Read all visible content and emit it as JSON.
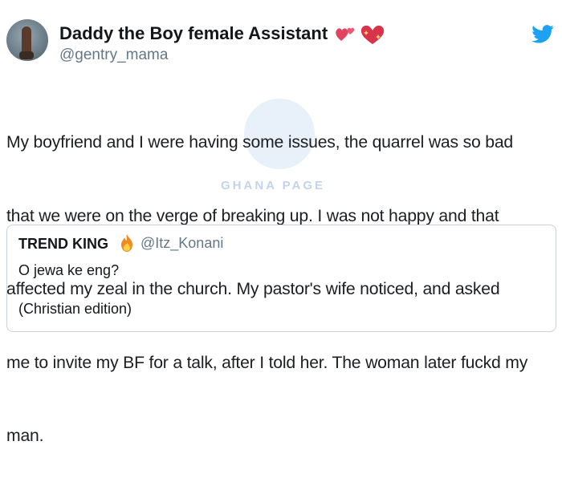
{
  "author": {
    "display_name": "Daddy the Boy female Assistant",
    "handle": "@gentry_mama",
    "name_emojis": [
      "two-hearts-icon",
      "sparkling-heart-icon"
    ]
  },
  "tweet": {
    "lines": [
      "My boyfriend and I were having some issues, the quarrel was so bad",
      "that we were on the verge of breaking up. I was not happy and that",
      "affected my zeal in the church. My pastor's wife noticed, and asked",
      "me to invite my BF for a talk, after I told her. The woman later fuckd my",
      "man."
    ]
  },
  "watermark": {
    "text": "GHANA PAGE"
  },
  "quote": {
    "name": "TREND KING",
    "handle": "@Itz_Konani",
    "name_emoji": "fire-icon",
    "line1": "O jewa ke eng?",
    "line2": "(Christian edition)"
  },
  "colors": {
    "twitter_blue": "#1da1f2",
    "heart_red": "#d8334a",
    "secondary_text": "#657786",
    "card_border": "#c9d1d8"
  }
}
